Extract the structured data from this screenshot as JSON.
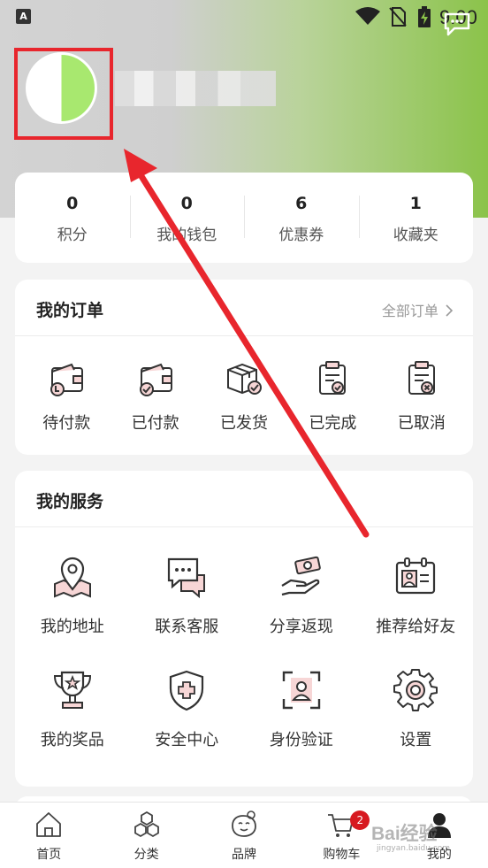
{
  "status_bar": {
    "time": "9:00"
  },
  "stats": [
    {
      "value": "0",
      "label": "积分"
    },
    {
      "value": "0",
      "label": "我的钱包"
    },
    {
      "value": "6",
      "label": "优惠券"
    },
    {
      "value": "1",
      "label": "收藏夹"
    }
  ],
  "orders": {
    "title": "我的订单",
    "all_link": "全部订单",
    "items": [
      {
        "label": "待付款",
        "icon": "wallet-pending-icon"
      },
      {
        "label": "已付款",
        "icon": "wallet-paid-icon"
      },
      {
        "label": "已发货",
        "icon": "package-shipped-icon"
      },
      {
        "label": "已完成",
        "icon": "clipboard-check-icon"
      },
      {
        "label": "已取消",
        "icon": "clipboard-cancel-icon"
      }
    ]
  },
  "services": {
    "title": "我的服务",
    "items": [
      {
        "label": "我的地址",
        "icon": "map-pin-icon"
      },
      {
        "label": "联系客服",
        "icon": "chat-bubble-icon"
      },
      {
        "label": "分享返现",
        "icon": "cash-hand-icon"
      },
      {
        "label": "推荐给好友",
        "icon": "contact-card-icon"
      },
      {
        "label": "我的奖品",
        "icon": "trophy-icon"
      },
      {
        "label": "安全中心",
        "icon": "shield-plus-icon"
      },
      {
        "label": "身份验证",
        "icon": "id-scan-icon"
      },
      {
        "label": "设置",
        "icon": "gear-icon"
      }
    ]
  },
  "tabbar": {
    "items": [
      {
        "label": "首页",
        "icon": "home-icon"
      },
      {
        "label": "分类",
        "icon": "category-icon"
      },
      {
        "label": "品牌",
        "icon": "brand-icon"
      },
      {
        "label": "购物车",
        "icon": "cart-icon",
        "badge": "2"
      },
      {
        "label": "我的",
        "icon": "profile-icon"
      }
    ]
  },
  "watermark": {
    "text": "Bai经验",
    "sub": "jingyan.baidu.com"
  },
  "colors": {
    "accent": "#e8262d",
    "icon_fill": "#f7d6d6",
    "header_green": "#8bc34a",
    "badge": "#d71920"
  }
}
